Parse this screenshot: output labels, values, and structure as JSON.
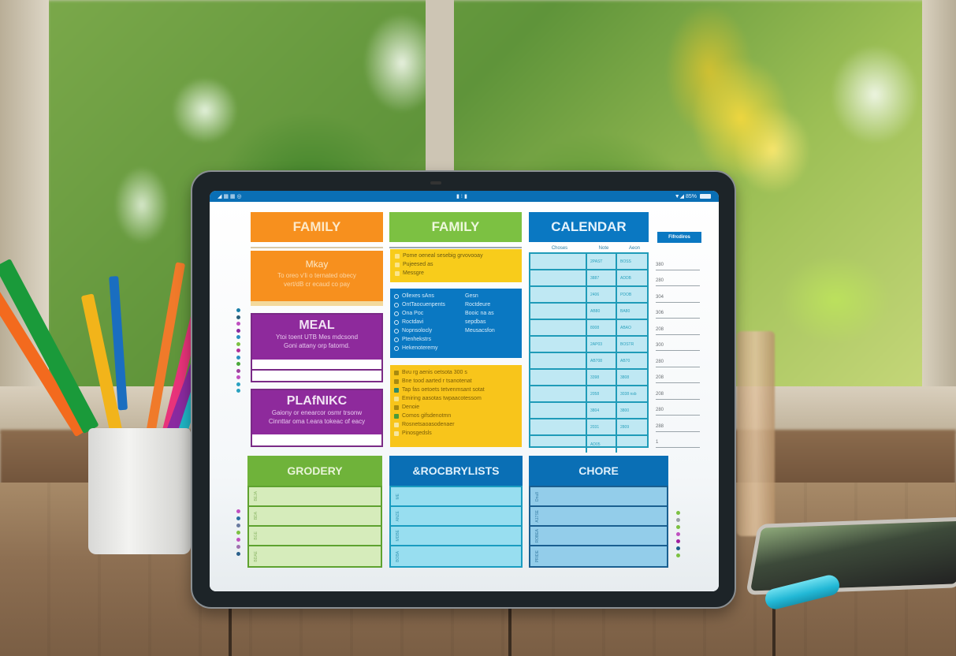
{
  "scene": {
    "description": "Tablet displaying a family planner app on a wooden table in front of a bright window",
    "objects": [
      "pencil-cup",
      "colored-pencils",
      "smartphone",
      "cyan-marker",
      "wooden-table",
      "window"
    ]
  },
  "tablet": {
    "statusbar": {
      "left": "◢ ▦ ▦ ◎",
      "center": "▮ ⁝ ▮",
      "right_signal": "▼◢ 85%"
    },
    "cards": {
      "family_orange": {
        "title": "FAMILY",
        "color": "#f7901e"
      },
      "family_green": {
        "title": "FAMILY",
        "color": "#7cc142"
      },
      "calendar": {
        "title": "CALENDAR",
        "color": "#0a78c2",
        "columns": [
          "Choses",
          "Note",
          "Aeon"
        ],
        "rows": [
          [
            "",
            "2PAST",
            "BOSS"
          ],
          [
            "",
            "3887",
            "ADDB"
          ],
          [
            "",
            "2406",
            "PDOB"
          ],
          [
            "",
            "AB80",
            "BA80"
          ],
          [
            "",
            "8008",
            "ABAO"
          ],
          [
            "",
            "2AP03",
            "BOSTR"
          ],
          [
            "",
            "AB708",
            "AB70"
          ],
          [
            "",
            "3398",
            "3808"
          ],
          [
            "",
            "2058",
            "3038 nsb"
          ],
          [
            "",
            "3804",
            "3800"
          ],
          [
            "",
            "2031",
            "2809"
          ],
          [
            "",
            "AD05",
            ""
          ]
        ]
      },
      "side_panel": {
        "button": "Fifrcdiros",
        "items": [
          "380",
          "280",
          "304",
          "306",
          "208",
          "300",
          "280",
          "208",
          "208",
          "280",
          "288",
          "1"
        ]
      },
      "orange_note": {
        "title": "Mkay",
        "lines": [
          "To oreo v'li o ternated obecy",
          "vert/dB cr ecaud co pay"
        ]
      },
      "yellow_small": {
        "lines": [
          "Pome oeneal sesebig grvovooay",
          "Pujeesed as",
          "Messgre"
        ]
      },
      "blue_list": {
        "left": [
          "Ollexes sAns",
          "OntTaocuenpents",
          "Ona Poc",
          "Roctdavi",
          "Nopnsolocly",
          "Ptenhekstrs",
          "Hekenoteremy"
        ],
        "right": [
          "",
          "",
          "Gesn",
          "Roctdeure",
          "Booic na as",
          "sepdbas",
          "Meusacsfon"
        ]
      },
      "meal": {
        "title": "MEAL",
        "color": "#8e2a9c",
        "lines": [
          "Ytoi toent UTB Mes mdcsond",
          "Goni attany orp fatornd."
        ]
      },
      "yellow_list": {
        "lines": [
          "Bvu rg aenis oetsota 300 s",
          "Bne tood aarted r tsanotenat",
          "Tap fas oetoets tetvenmsant sotat",
          "Emiring aasotas twpaacotessom",
          "Denoie",
          "Comos gifsdenotmn",
          "Rosnetsaoasodenaer",
          "Pinosgedsls"
        ]
      },
      "planikc": {
        "title": "PLAfNIKC",
        "color": "#8e2a9c",
        "lines": [
          "Gaiony or enearcor osmr trsonw",
          "Cinnttar oma t.eara tokeac of eacy"
        ]
      },
      "grocery": {
        "title": "GRODERY",
        "color": "#7cc142",
        "rows": [
          "BEJA",
          "BDA",
          "BGE",
          "BDAE"
        ]
      },
      "grocery_lists": {
        "title": "&ROCBRYLISTS",
        "color": "#0a6fb5",
        "rows": [
          "ME",
          "ANZE",
          "MDBE",
          "BOBA"
        ]
      },
      "chore": {
        "title": "CHORE",
        "color": "#0a6fb5",
        "rows": [
          "Dnu8",
          "A17SE",
          "ROBEA",
          "PRIDE"
        ]
      }
    }
  }
}
